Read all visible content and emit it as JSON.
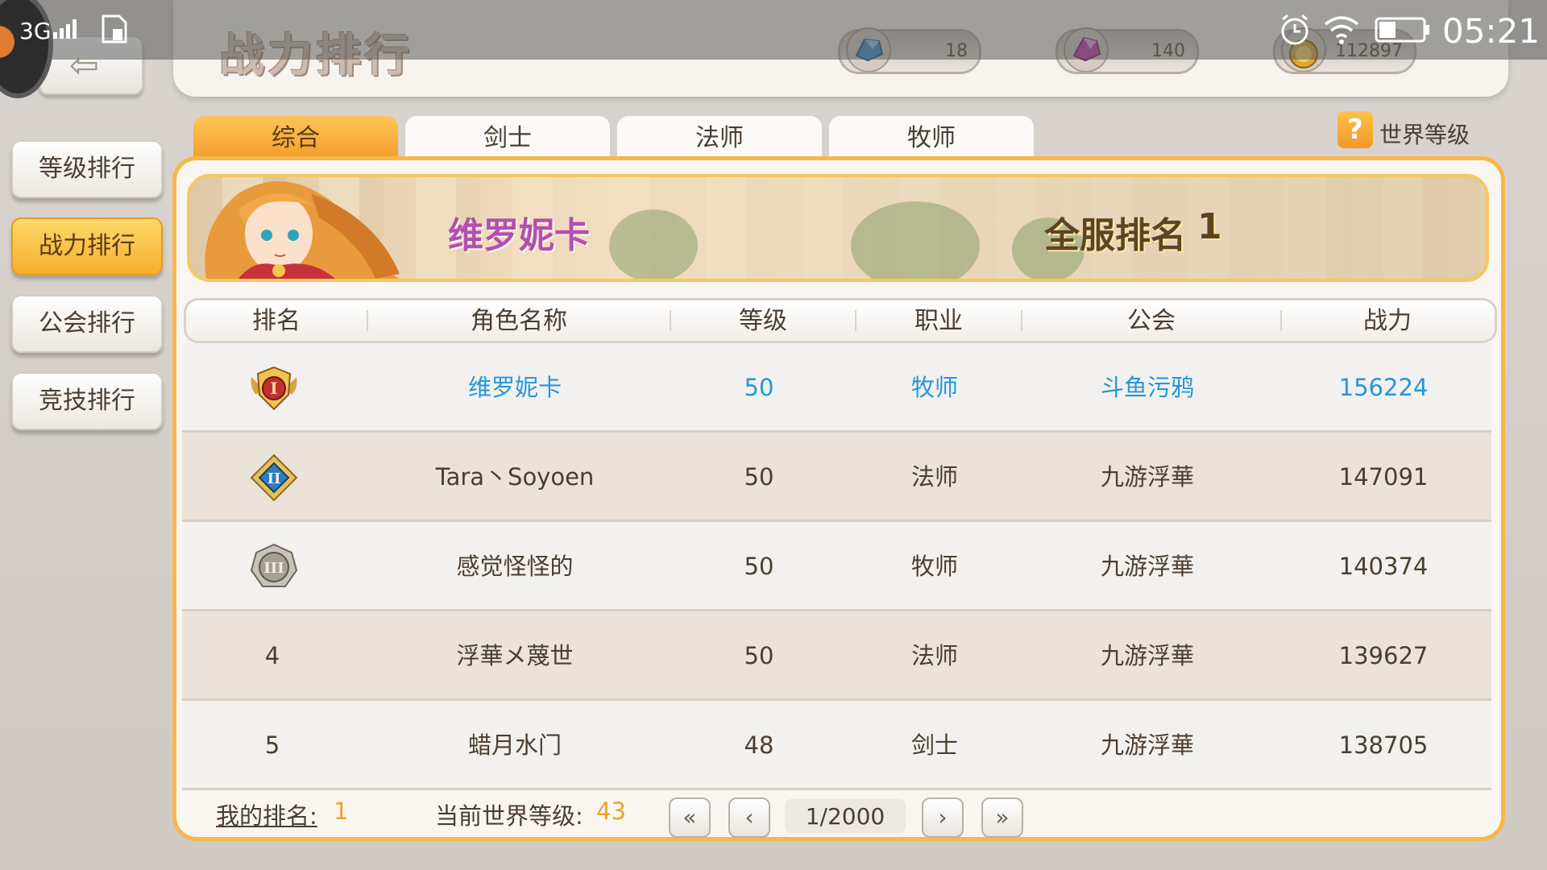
{
  "status_bar": {
    "network": "3G",
    "time": "05:21"
  },
  "header": {
    "title": "战力排行",
    "currencies": [
      {
        "name": "blue-gem",
        "value": "18",
        "color": "#3a8fd0"
      },
      {
        "name": "purple-gem",
        "value": "140",
        "color": "#c43aa6"
      },
      {
        "name": "gold-coin",
        "value": "112897",
        "color": "#e0a62e"
      }
    ]
  },
  "sidebar": {
    "items": [
      {
        "label": "等级排行",
        "active": false
      },
      {
        "label": "战力排行",
        "active": true
      },
      {
        "label": "公会排行",
        "active": false
      },
      {
        "label": "竞技排行",
        "active": false
      }
    ]
  },
  "tabs": [
    {
      "label": "综合",
      "active": true
    },
    {
      "label": "剑士",
      "active": false
    },
    {
      "label": "法师",
      "active": false
    },
    {
      "label": "牧师",
      "active": false
    }
  ],
  "world_level_link": {
    "icon": "?",
    "label": "世界等级"
  },
  "banner": {
    "character_name": "维罗妮卡",
    "server_rank_label": "全服排名",
    "server_rank_value": "1"
  },
  "table": {
    "headers": [
      "排名",
      "角色名称",
      "等级",
      "职业",
      "公会",
      "战力"
    ],
    "rows": [
      {
        "rank": "1",
        "rank_badge": "I",
        "name": "维罗妮卡",
        "level": "50",
        "class": "牧师",
        "guild": "斗鱼污鸦",
        "power": "156224",
        "is_me": true
      },
      {
        "rank": "2",
        "rank_badge": "II",
        "name": "Tara丶Soyoen",
        "level": "50",
        "class": "法师",
        "guild": "九游浮華",
        "power": "147091",
        "is_me": false
      },
      {
        "rank": "3",
        "rank_badge": "III",
        "name": "感觉怪怪的",
        "level": "50",
        "class": "牧师",
        "guild": "九游浮華",
        "power": "140374",
        "is_me": false
      },
      {
        "rank": "4",
        "rank_badge": "",
        "name": "浮華メ蔑世",
        "level": "50",
        "class": "法师",
        "guild": "九游浮華",
        "power": "139627",
        "is_me": false
      },
      {
        "rank": "5",
        "rank_badge": "",
        "name": "蜡月水门",
        "level": "48",
        "class": "剑士",
        "guild": "九游浮華",
        "power": "138705",
        "is_me": false
      }
    ]
  },
  "footer": {
    "my_rank_label": "我的排名:",
    "my_rank_value": "1",
    "world_level_label": "当前世界等级:",
    "world_level_value": "43",
    "page": "1/2000",
    "first_page": "«",
    "prev_page": "‹",
    "next_page": "›",
    "last_page": "»"
  }
}
